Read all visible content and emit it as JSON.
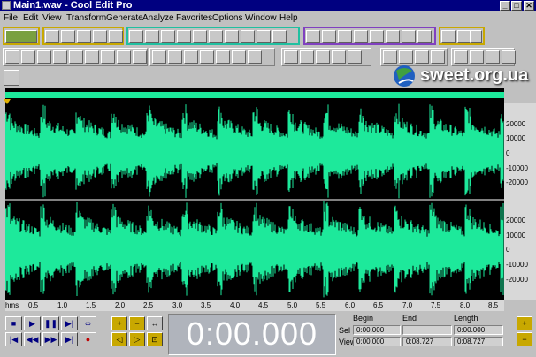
{
  "window": {
    "title": "Main1.wav - Cool Edit Pro",
    "min_label": "_",
    "max_label": "□",
    "close_label": "✕"
  },
  "menu": [
    "File",
    "Edit",
    "View",
    "Transform",
    "Generate",
    "Analyze",
    "Favorites",
    "Options",
    "Window",
    "Help"
  ],
  "watermark": {
    "text": "sweet.org.ua"
  },
  "waveform": {
    "y_ticks_top": [
      "20000",
      "10000",
      "0",
      "-10000",
      "-20000"
    ],
    "y_ticks_bottom": [
      "20000",
      "10000",
      "0",
      "-10000",
      "-20000"
    ],
    "unit_label": "hms",
    "time_ticks": [
      "0.5",
      "1.0",
      "1.5",
      "2.0",
      "2.5",
      "3.0",
      "3.5",
      "4.0",
      "4.5",
      "5.0",
      "5.5",
      "6.0",
      "6.5",
      "7.0",
      "7.5",
      "8.0",
      "8.5"
    ],
    "color": "#1de99b"
  },
  "time_display": "0:00.000",
  "selection": {
    "headers": {
      "begin": "Begin",
      "end": "End",
      "length": "Length"
    },
    "sel_label": "Sel",
    "view_label": "View",
    "sel_begin": "0:00.000",
    "sel_end": "",
    "sel_length": "0:00.000",
    "view_begin": "0:00.000",
    "view_end": "0:08.727",
    "view_length": "0:08.727"
  }
}
